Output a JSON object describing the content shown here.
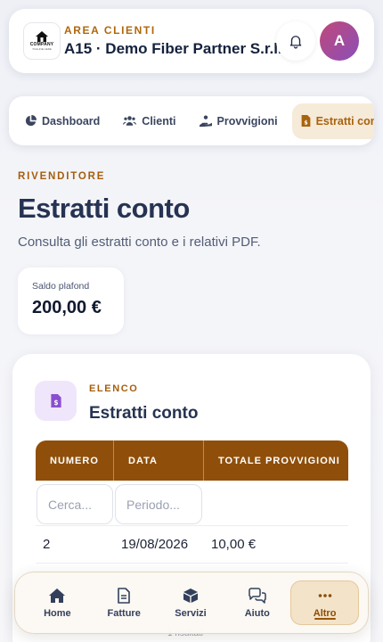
{
  "header": {
    "logo": {
      "text": "COMPANY",
      "subtext": "TAGLINE HERE"
    },
    "kicker": "AREA CLIENTI",
    "title": "A15 · Demo Fiber Partner S.r.l.",
    "avatar_initial": "A"
  },
  "tabs": [
    {
      "label": "Dashboard",
      "icon": "pie-chart-icon",
      "active": false
    },
    {
      "label": "Clienti",
      "icon": "users-icon",
      "active": false
    },
    {
      "label": "Provvigioni",
      "icon": "hand-coins-icon",
      "active": false
    },
    {
      "label": "Estratti conto",
      "icon": "file-invoice-icon",
      "active": true
    }
  ],
  "page": {
    "kicker": "RIVENDITORE",
    "title": "Estratti conto",
    "subtitle": "Consulta gli estratti conto e i relativi PDF."
  },
  "balance": {
    "label": "Saldo plafond",
    "value": "200,00 €"
  },
  "card": {
    "kicker": "ELENCO",
    "title": "Estratti conto",
    "columns": [
      "NUMERO",
      "DATA",
      "TOTALE PROVVIGIONI"
    ],
    "filters": {
      "numero_placeholder": "Cerca...",
      "data_placeholder": "Periodo..."
    },
    "rows": [
      {
        "numero": "2",
        "data": "19/08/2026",
        "totale": "10,00 €"
      }
    ],
    "footer_peek": "1 risultati"
  },
  "bottom_nav": [
    {
      "label": "Home",
      "icon": "home-icon",
      "active": false
    },
    {
      "label": "Fatture",
      "icon": "document-icon",
      "active": false
    },
    {
      "label": "Servizi",
      "icon": "box-icon",
      "active": false
    },
    {
      "label": "Aiuto",
      "icon": "chat-bubbles-icon",
      "active": false
    },
    {
      "label": "Altro",
      "icon": "more-dots-icon",
      "active": true
    }
  ],
  "colors": {
    "accent": "#a65e0c",
    "table_header": "#8f4f0a",
    "active_tab_bg": "#f6ead8",
    "avatar_gradient": [
      "#c0487a",
      "#8a4fb8"
    ]
  }
}
